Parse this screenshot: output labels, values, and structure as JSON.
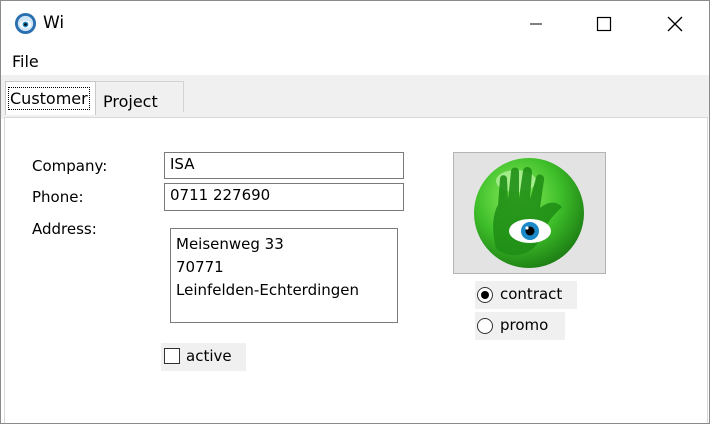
{
  "window": {
    "title": "Wi",
    "icon": "eye-hand-logo-icon",
    "controls": {
      "minimize": "minimize-icon",
      "maximize": "maximize-icon",
      "close": "close-icon"
    }
  },
  "menu": {
    "file": "File"
  },
  "tabs": [
    {
      "label": "Customer",
      "active": true
    },
    {
      "label": "Project",
      "active": false
    }
  ],
  "form": {
    "company_label": "Company:",
    "company_value": "ISA",
    "phone_label": "Phone:",
    "phone_value": "0711 227690",
    "address_label": "Address:",
    "address_lines": [
      "Meisenweg 33",
      "70771",
      "Leinfelden-Echterdingen"
    ],
    "active_label": "active",
    "active_checked": false
  },
  "logo": {
    "icon": "green-hand-eye-logo-icon"
  },
  "radios": [
    {
      "label": "contract",
      "selected": true
    },
    {
      "label": "promo",
      "selected": false
    }
  ],
  "colors": {
    "tab_strip_bg": "#f0f0f0",
    "logo_green": "#3fbf2a",
    "logo_dark_green": "#1a7a12",
    "eye_blue": "#1b88c7"
  }
}
